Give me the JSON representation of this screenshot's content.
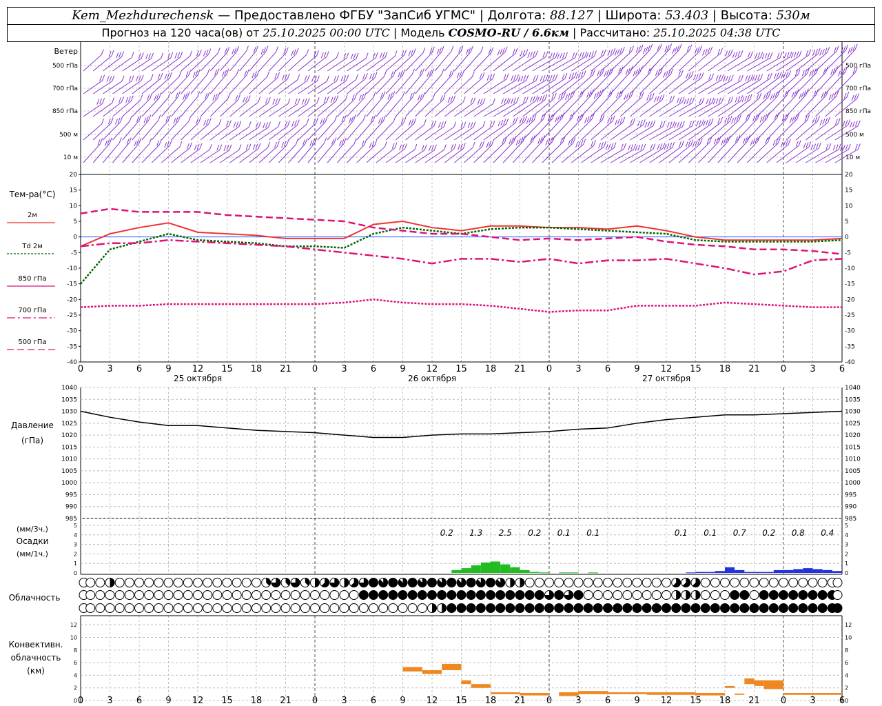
{
  "header": {
    "station": "Kem_Mezhdurechensk",
    "provided": "Предоставлено ФГБУ \"ЗапСиб УГМС\"",
    "lon_label": "Долгота:",
    "lon": "88.127",
    "lat_label": "Широта:",
    "lat": "53.403",
    "alt_label": "Высота:",
    "alt": "530м",
    "forecast_label": "Прогноз на 120 часа(ов) от",
    "forecast_time": "25.10.2025 00:00 UTC",
    "model_label": "Модель",
    "model": "COSMO-RU / 6.6км",
    "calc_label": "Рассчитано:",
    "calc_time": "25.10.2025 04:38 UTC"
  },
  "labels": {
    "wind_title": "Ветер",
    "wind_levels": [
      "500 гПа",
      "700 гПа",
      "850 гПа",
      "500 м",
      "10 м"
    ],
    "temp_title": "Тем-ра(°C)",
    "temp_legend": [
      "2м",
      "Td 2м",
      "850 гПа",
      "700 гПа",
      "500 гПа"
    ],
    "pressure_title": "Давление",
    "pressure_units": "(гПа)",
    "precip_units_3h": "(мм/3ч.)",
    "precip_title": "Осадки",
    "precip_units_1h": "(мм/1ч.)",
    "cloud_title": "Облачность",
    "conv_title_1": "Конвективн.",
    "conv_title_2": "облачность",
    "conv_units": "(км)"
  },
  "chart_data": [
    {
      "type": "line",
      "panel": "temperature",
      "x_hours": [
        0,
        3,
        6,
        9,
        12,
        15,
        18,
        21,
        24,
        27,
        30,
        33,
        36,
        39,
        42,
        45,
        48,
        51,
        54,
        57,
        60,
        63,
        66,
        69,
        72,
        75,
        78
      ],
      "x_tick_labels": [
        "0",
        "3",
        "6",
        "9",
        "12",
        "15",
        "18",
        "21",
        "0",
        "3",
        "6",
        "9",
        "12",
        "15",
        "18",
        "21",
        "0",
        "3",
        "6",
        "9",
        "12",
        "15",
        "18",
        "21",
        "0",
        "3",
        "6"
      ],
      "date_labels": [
        "25 октября",
        "26 октября",
        "27 октября"
      ],
      "ylim": [
        -40,
        20
      ],
      "y_ticks": [
        "20",
        "15",
        "10",
        "5",
        "0",
        "-5",
        "-10",
        "-15",
        "-20",
        "-25",
        "-30",
        "-35",
        "-40"
      ],
      "series": [
        {
          "name": "2м",
          "color": "#ee3333",
          "style": "solid",
          "values": [
            -3,
            1,
            3,
            4.5,
            1.5,
            1,
            0.5,
            -0.5,
            -0.5,
            -0.5,
            4,
            5,
            3,
            2,
            3.5,
            3.5,
            3,
            3,
            2.5,
            3.5,
            2,
            0,
            -1,
            -1,
            -1,
            -1,
            -0.5
          ]
        },
        {
          "name": "Td 2м",
          "color": "#006600",
          "style": "dotted",
          "values": [
            -15,
            -4,
            -1.5,
            1,
            -1,
            -1.5,
            -2,
            -3,
            -3,
            -3.5,
            1,
            3,
            2,
            1,
            2.5,
            3,
            3,
            2.5,
            2,
            1.5,
            1,
            -1,
            -1.5,
            -1.5,
            -1.5,
            -1.5,
            -1
          ]
        },
        {
          "name": "850 гПа",
          "color": "#dd1177",
          "style": "dash",
          "values": [
            7.5,
            9,
            8,
            8,
            8,
            7,
            6.5,
            6,
            5.5,
            5,
            3,
            2,
            1,
            1,
            0,
            -1,
            -0.5,
            -1,
            -0.5,
            0,
            -1.5,
            -2.5,
            -3,
            -4,
            -4,
            -4.5,
            -5.5
          ]
        },
        {
          "name": "700 гПа",
          "color": "#dd1177",
          "style": "dashdot",
          "values": [
            -3,
            -2,
            -2,
            -1,
            -1.5,
            -2,
            -2.5,
            -3,
            -4,
            -5,
            -6,
            -7,
            -8.5,
            -7,
            -7,
            -8,
            -7,
            -8.5,
            -7.5,
            -7.5,
            -7,
            -8.5,
            -10,
            -12,
            -11,
            -7.5,
            -7
          ]
        },
        {
          "name": "500 гПа",
          "color": "#dd1177",
          "style": "dotted",
          "values": [
            -22.5,
            -22,
            -22,
            -21.5,
            -21.5,
            -21.5,
            -21.5,
            -21.5,
            -21.5,
            -21,
            -20,
            -21,
            -21.5,
            -21.5,
            -22,
            -23,
            -24,
            -23.5,
            -23.5,
            -22,
            -22,
            -22,
            -21,
            -21.5,
            -22,
            -22.5,
            -22.5
          ]
        }
      ]
    },
    {
      "type": "line",
      "panel": "pressure",
      "ylim": [
        985,
        1040
      ],
      "y_ticks": [
        "1040",
        "1035",
        "1030",
        "1025",
        "1020",
        "1015",
        "1010",
        "1005",
        "1000",
        "995",
        "990",
        "985"
      ],
      "x_hours": [
        0,
        3,
        6,
        9,
        12,
        15,
        18,
        21,
        24,
        27,
        30,
        33,
        36,
        39,
        42,
        45,
        48,
        51,
        54,
        57,
        60,
        63,
        66,
        69,
        72,
        75,
        78
      ],
      "series": [
        {
          "name": "Давление",
          "color": "#000000",
          "values": [
            1030,
            1027.5,
            1025.5,
            1024,
            1024,
            1023,
            1022,
            1021.5,
            1021,
            1020,
            1019,
            1019,
            1020,
            1020.5,
            1020.5,
            1021,
            1021.5,
            1022.5,
            1023,
            1025,
            1026.5,
            1027.5,
            1028.5,
            1028.5,
            1029,
            1029.5,
            1030
          ]
        }
      ]
    },
    {
      "type": "bar",
      "panel": "precipitation",
      "ylim": [
        0,
        5
      ],
      "y_ticks": [
        "5",
        "4",
        "3",
        "2",
        "1",
        "0"
      ],
      "totals_3h": [
        {
          "hour": 37.5,
          "label": "0.2"
        },
        {
          "hour": 40.5,
          "label": "1.3"
        },
        {
          "hour": 43.5,
          "label": "2.5"
        },
        {
          "hour": 46.5,
          "label": "0.2"
        },
        {
          "hour": 49.5,
          "label": "0.1"
        },
        {
          "hour": 52.5,
          "label": "0.1"
        },
        {
          "hour": 61.5,
          "label": "0.1"
        },
        {
          "hour": 64.5,
          "label": "0.1"
        },
        {
          "hour": 67.5,
          "label": "0.7"
        },
        {
          "hour": 70.5,
          "label": "0.2"
        },
        {
          "hour": 73.5,
          "label": "0.8"
        },
        {
          "hour": 76.5,
          "label": "0.4"
        }
      ],
      "series": [
        {
          "name": "rain",
          "color": "#22bb22",
          "bars": [
            [
              38,
              0.3
            ],
            [
              39,
              0.5
            ],
            [
              40,
              0.8
            ],
            [
              41,
              1.1
            ],
            [
              42,
              1.2
            ],
            [
              43,
              0.9
            ],
            [
              44,
              0.6
            ],
            [
              45,
              0.3
            ],
            [
              46,
              0.1
            ],
            [
              47,
              0.05
            ],
            [
              49,
              0.05
            ],
            [
              50,
              0.05
            ],
            [
              52,
              0.05
            ]
          ]
        },
        {
          "name": "snow",
          "color": "#2233dd",
          "bars": [
            [
              62,
              0.05
            ],
            [
              63,
              0.1
            ],
            [
              64,
              0.1
            ],
            [
              65,
              0.2
            ],
            [
              66,
              0.6
            ],
            [
              67,
              0.3
            ],
            [
              68,
              0.1
            ],
            [
              69,
              0.1
            ],
            [
              70,
              0.1
            ],
            [
              71,
              0.3
            ],
            [
              72,
              0.3
            ],
            [
              73,
              0.4
            ],
            [
              74,
              0.5
            ],
            [
              75,
              0.4
            ],
            [
              76,
              0.3
            ],
            [
              77,
              0.2
            ]
          ]
        }
      ]
    },
    {
      "type": "table",
      "panel": "cloudiness",
      "rows": [
        {
          "name": "upper",
          "values": [
            0,
            0,
            0,
            2,
            0,
            0,
            0,
            0,
            0,
            0,
            0,
            0,
            0,
            0,
            0,
            0,
            0,
            0,
            0,
            0,
            0,
            0,
            0,
            0,
            0,
            0,
            0,
            0,
            0,
            0,
            0,
            0,
            0,
            0,
            0,
            0,
            0,
            0,
            0,
            0,
            0,
            0,
            0,
            0,
            0,
            0,
            0,
            0,
            0,
            0,
            0,
            0,
            0,
            0,
            0,
            0,
            0,
            0,
            0,
            0,
            0,
            0,
            0,
            0,
            0,
            0,
            0,
            0,
            0,
            0,
            0,
            0,
            0,
            0,
            0,
            0,
            0,
            0,
            0
          ]
        },
        {
          "name": "middle",
          "values": [
            0,
            0,
            0,
            0,
            0,
            0,
            0,
            0,
            0,
            0,
            0,
            0,
            0,
            0,
            0,
            0,
            0,
            0,
            0,
            0,
            0,
            0,
            0,
            0,
            0,
            0,
            0,
            0,
            0,
            0,
            0,
            0,
            0,
            0,
            0,
            0,
            0,
            0,
            0,
            0,
            0,
            0,
            0,
            0,
            0,
            0,
            0,
            0,
            0,
            0,
            0,
            0,
            0,
            0,
            0,
            0,
            0,
            0,
            0,
            0,
            0,
            0,
            0,
            0,
            0,
            0,
            0,
            0,
            0,
            0,
            0,
            0,
            0,
            0,
            0,
            0,
            0,
            0,
            0
          ]
        },
        {
          "name": "lower",
          "values": [
            0,
            0,
            0,
            0,
            0,
            0,
            0,
            0,
            0,
            0,
            0,
            0,
            0,
            0,
            0,
            0,
            0,
            0,
            0,
            0,
            0,
            0,
            0,
            0,
            0,
            0,
            0,
            0,
            0,
            0,
            0,
            0,
            0,
            0,
            0,
            0,
            0,
            0,
            0,
            0,
            0,
            0,
            0,
            0,
            0,
            0,
            0,
            0,
            0,
            0,
            0,
            0,
            0,
            0,
            0,
            0,
            0,
            0,
            0,
            0,
            0,
            0,
            0,
            0,
            0,
            0,
            0,
            0,
            0,
            0,
            0,
            0,
            0,
            0,
            0,
            0,
            0,
            0,
            0
          ]
        }
      ],
      "note": "values are eighths of sky cover 0–8 per hourly circle"
    },
    {
      "type": "bar",
      "panel": "convective_cloudiness",
      "ylim": [
        0,
        13
      ],
      "y_ticks": [
        "12",
        "10",
        "8",
        "6",
        "4",
        "2",
        "0"
      ],
      "color": "#ee8822",
      "segments": [
        [
          33,
          35,
          4.6,
          5.3
        ],
        [
          35,
          37,
          4.2,
          4.8
        ],
        [
          37,
          39,
          4.8,
          5.8
        ],
        [
          39,
          40,
          2.6,
          3.2
        ],
        [
          40,
          42,
          2.0,
          2.6
        ],
        [
          42,
          45,
          1.0,
          1.3
        ],
        [
          45,
          48,
          0.8,
          1.2
        ],
        [
          49,
          51,
          0.7,
          1.3
        ],
        [
          51,
          54,
          1.0,
          1.5
        ],
        [
          54,
          58,
          1.0,
          1.3
        ],
        [
          58,
          63,
          0.9,
          1.3
        ],
        [
          63,
          66,
          0.8,
          1.2
        ],
        [
          66,
          67,
          2.0,
          2.3
        ],
        [
          67,
          68,
          0.9,
          1.1
        ],
        [
          68,
          69,
          2.6,
          3.5
        ],
        [
          69,
          70,
          2.3,
          3.2
        ],
        [
          70,
          72,
          1.8,
          3.2
        ],
        [
          72,
          78,
          0.9,
          1.2
        ]
      ]
    }
  ]
}
